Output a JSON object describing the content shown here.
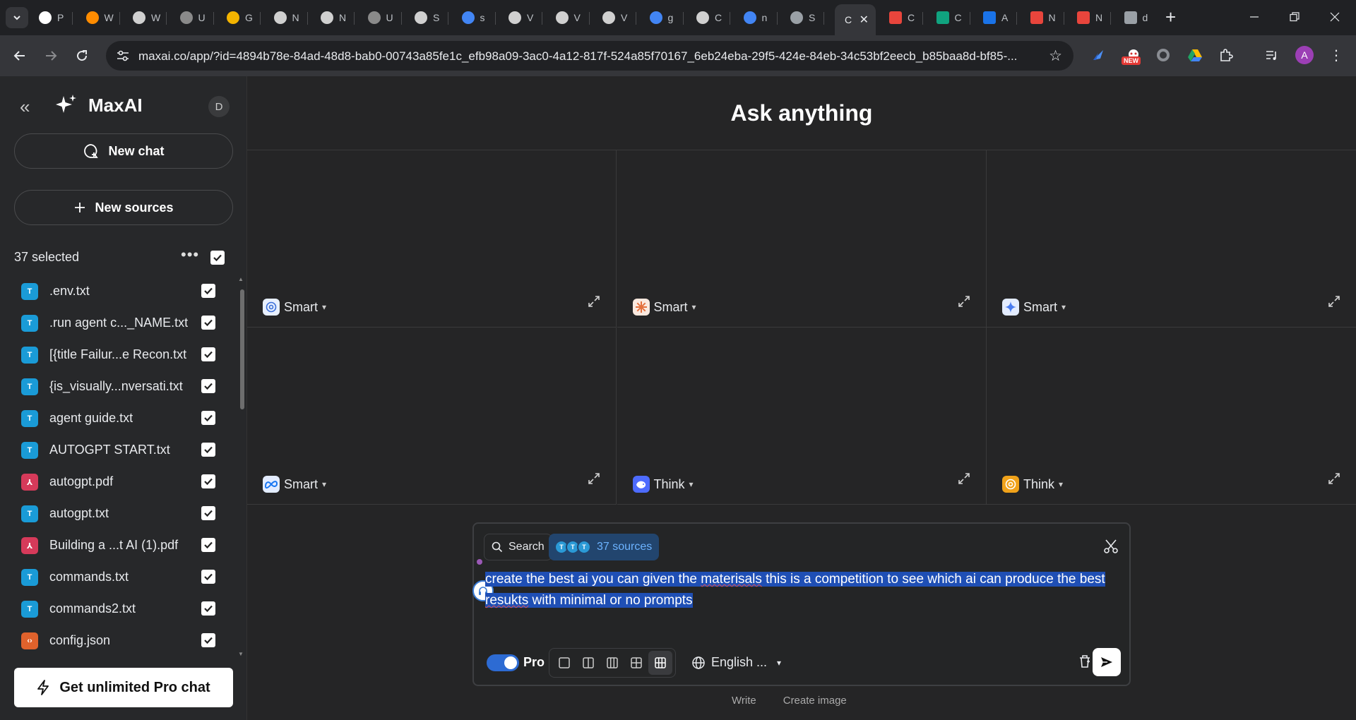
{
  "browser": {
    "tabs": [
      {
        "label": "P",
        "color": "#ffffff"
      },
      {
        "label": "W",
        "color": "#ff8c00"
      },
      {
        "label": "W",
        "color": "#d0d0d0"
      },
      {
        "label": "U",
        "color": "#8a8a8a"
      },
      {
        "label": "G",
        "color": "#f4b400"
      },
      {
        "label": "N",
        "color": "#d0d0d0"
      },
      {
        "label": "N",
        "color": "#d0d0d0"
      },
      {
        "label": "U",
        "color": "#8a8a8a"
      },
      {
        "label": "S",
        "color": "#d0d0d0"
      },
      {
        "label": "s",
        "color": "#4285f4"
      },
      {
        "label": "V",
        "color": "#d0d0d0"
      },
      {
        "label": "V",
        "color": "#d0d0d0"
      },
      {
        "label": "V",
        "color": "#d0d0d0"
      },
      {
        "label": "g",
        "color": "#4285f4"
      },
      {
        "label": "C",
        "color": "#d0d0d0"
      },
      {
        "label": "n",
        "color": "#4285f4"
      },
      {
        "label": "S",
        "color": "#9aa0a6"
      }
    ],
    "active_tab": {
      "label": "C",
      "close": "✕"
    },
    "tabs_after": [
      {
        "label": "C",
        "color": "#e8453c"
      },
      {
        "label": "C",
        "color": "#10a37f"
      },
      {
        "label": "A",
        "color": "#1a73e8"
      },
      {
        "label": "N",
        "color": "#e8453c"
      },
      {
        "label": "N",
        "color": "#e8453c"
      },
      {
        "label": "d",
        "color": "#9aa0a6"
      }
    ],
    "new_tab": "+",
    "url": "maxai.co/app/?id=4894b78e-84ad-48d8-bab0-00743a85fe1c_efb98a09-3ac0-4a12-817f-524a85f70167_6eb24eba-29f5-424e-84eb-34c53bf2eecb_b85baa8d-bf85-...",
    "ext_badge_new": "NEW",
    "profile_initial": "A"
  },
  "sidebar": {
    "brand": "MaxAI",
    "user_initial": "D",
    "new_chat": "New chat",
    "new_sources": "New sources",
    "selected_label": "37 selected",
    "more": "•••",
    "files": [
      {
        "name": ".env.txt",
        "type": "T",
        "color": "#1a9bd7"
      },
      {
        "name": ".run agent c..._NAME.txt",
        "type": "T",
        "color": "#1a9bd7"
      },
      {
        "name": "[{title Failur...e Recon.txt",
        "type": "T",
        "color": "#1a9bd7"
      },
      {
        "name": "{is_visually...nversati.txt",
        "type": "T",
        "color": "#1a9bd7"
      },
      {
        "name": "agent guide.txt",
        "type": "T",
        "color": "#1a9bd7"
      },
      {
        "name": "AUTOGPT START.txt",
        "type": "T",
        "color": "#1a9bd7"
      },
      {
        "name": "autogpt.pdf",
        "type": "⅄",
        "color": "#d63a5a"
      },
      {
        "name": "autogpt.txt",
        "type": "T",
        "color": "#1a9bd7"
      },
      {
        "name": "Building a ...t AI (1).pdf",
        "type": "⅄",
        "color": "#d63a5a"
      },
      {
        "name": "commands.txt",
        "type": "T",
        "color": "#1a9bd7"
      },
      {
        "name": "commands2.txt",
        "type": "T",
        "color": "#1a9bd7"
      },
      {
        "name": "config.json",
        "type": "‹›",
        "color": "#e0622c"
      }
    ],
    "upgrade": "Get unlimited Pro chat"
  },
  "main": {
    "title": "Ask anything",
    "panels": [
      {
        "mode": "Smart",
        "icon": "openai-icon",
        "icon_color": "#ffffff",
        "icon_bg": "#e8f0ff"
      },
      {
        "mode": "Smart",
        "icon": "claude-icon",
        "icon_color": "#e4703d",
        "icon_bg": "#fbe9df"
      },
      {
        "mode": "Smart",
        "icon": "gemini-icon",
        "icon_color": "#4a7cf0",
        "icon_bg": "#e3ecff"
      },
      {
        "mode": "Smart",
        "icon": "meta-icon",
        "icon_color": "#1877f2",
        "icon_bg": "#e3ecff"
      },
      {
        "mode": "Think",
        "icon": "deepseek-icon",
        "icon_color": "#ffffff",
        "icon_bg": "#4d6bfe"
      },
      {
        "mode": "Think",
        "icon": "openai-o-icon",
        "icon_color": "#ffffff",
        "icon_bg": "#f0a21a"
      }
    ]
  },
  "composer": {
    "search": "Search",
    "sources": "37 sources",
    "prompt_a": "create the best ai you can given the ",
    "prompt_typo1": "materisals",
    "prompt_b": " this is a competition to see which ai can produce the best ",
    "prompt_typo2": "resukts",
    "prompt_c": " with minimal or no prompts",
    "pro_label": "Pro",
    "pro_enabled": true,
    "language": "English ...",
    "modes": [
      "Write",
      "Create image"
    ]
  }
}
